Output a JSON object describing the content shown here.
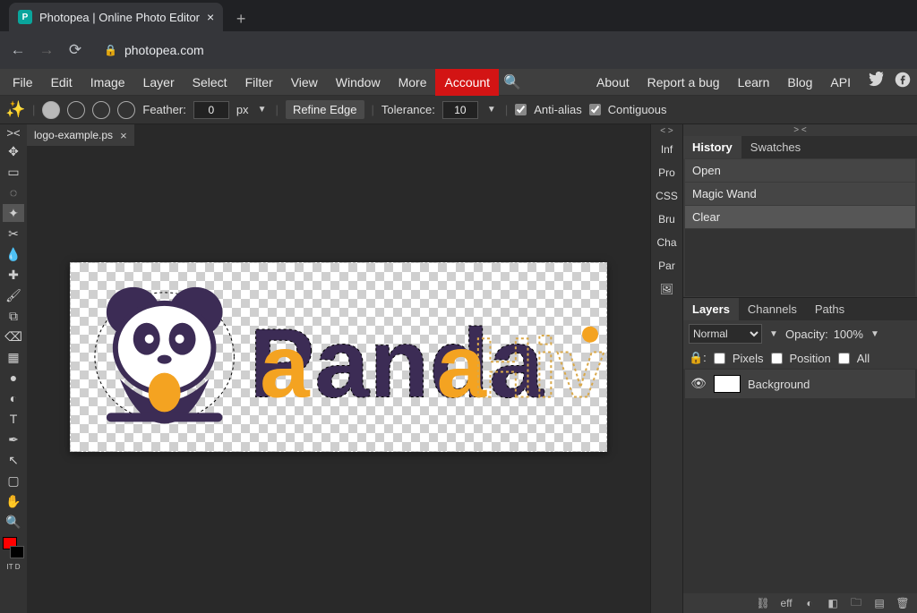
{
  "browser": {
    "tab_title": "Photopea | Online Photo Editor",
    "url": "photopea.com"
  },
  "menu": {
    "items": [
      "File",
      "Edit",
      "Image",
      "Layer",
      "Select",
      "Filter",
      "View",
      "Window",
      "More"
    ],
    "account": "Account",
    "right": [
      "About",
      "Report a bug",
      "Learn",
      "Blog",
      "API"
    ]
  },
  "options": {
    "feather_label": "Feather:",
    "feather_value": "0",
    "feather_unit": "px",
    "refine": "Refine Edge",
    "tolerance_label": "Tolerance:",
    "tolerance_value": "10",
    "antialias": "Anti-alias",
    "contiguous": "Contiguous"
  },
  "document": {
    "tab_name": "logo-example.ps"
  },
  "mini_panels": [
    "Inf",
    "Pro",
    "CSS",
    "Bru",
    "Cha",
    "Par"
  ],
  "history_panel": {
    "tabs": [
      "History",
      "Swatches"
    ],
    "items": [
      "Open",
      "Magic Wand",
      "Clear"
    ]
  },
  "layers_panel": {
    "tabs": [
      "Layers",
      "Channels",
      "Paths"
    ],
    "blend_mode": "Normal",
    "opacity_label": "Opacity:",
    "opacity_value": "100%",
    "lock_pixels": "Pixels",
    "lock_position": "Position",
    "lock_all": "All",
    "layer_name": "Background",
    "footer_eff": "eff"
  },
  "logo": {
    "word1": "Panda",
    "word2": "Hive"
  }
}
